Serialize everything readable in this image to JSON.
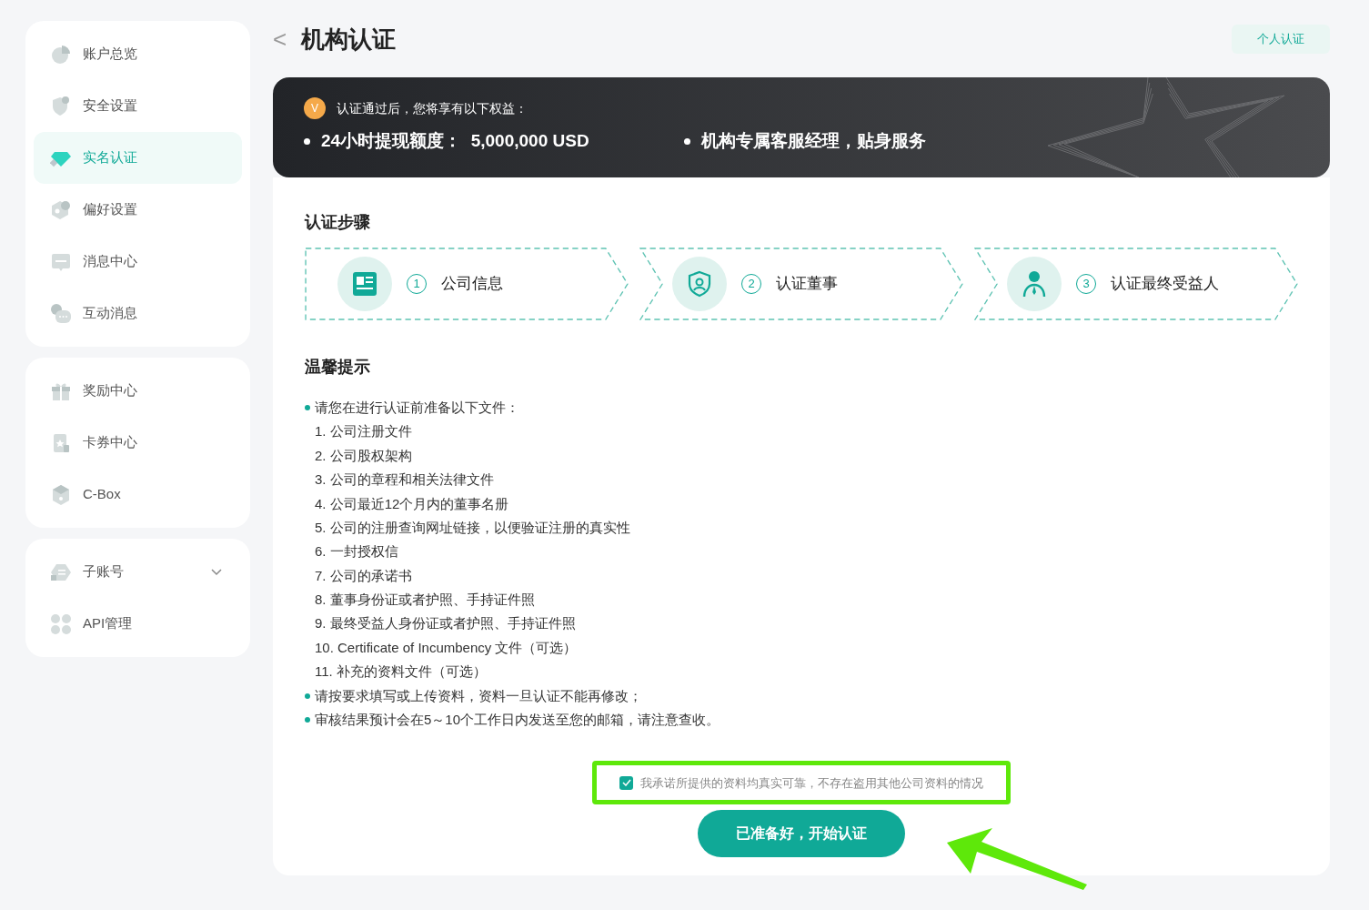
{
  "sidebar": {
    "groups": [
      {
        "items": [
          {
            "label": "账户总览",
            "selected": false
          },
          {
            "label": "安全设置",
            "selected": false
          },
          {
            "label": "实名认证",
            "selected": true
          },
          {
            "label": "偏好设置",
            "selected": false
          },
          {
            "label": "消息中心",
            "selected": false
          },
          {
            "label": "互动消息",
            "selected": false
          }
        ]
      },
      {
        "items": [
          {
            "label": "奖励中心",
            "selected": false
          },
          {
            "label": "卡券中心",
            "selected": false
          },
          {
            "label": "C-Box",
            "selected": false
          }
        ]
      },
      {
        "items": [
          {
            "label": "子账号",
            "selected": false,
            "expandable": true
          },
          {
            "label": "API管理",
            "selected": false
          }
        ]
      }
    ]
  },
  "header": {
    "back": "<",
    "title": "机构认证",
    "action": "个人认证"
  },
  "banner": {
    "badge": "V",
    "intro": "认证通过后，您将享有以下权益：",
    "benefits": [
      "24小时提现额度：  5,000,000 USD",
      "机构专属客服经理，贴身服务"
    ]
  },
  "steps": {
    "title": "认证步骤",
    "items": [
      {
        "number": "1",
        "label": "公司信息"
      },
      {
        "number": "2",
        "label": "认证董事"
      },
      {
        "number": "3",
        "label": "认证最终受益人"
      }
    ]
  },
  "tips": {
    "title": "温馨提示",
    "lines": [
      {
        "kind": "bullet",
        "text": "请您在进行认证前准备以下文件："
      },
      {
        "kind": "numbered",
        "text": "1. 公司注册文件"
      },
      {
        "kind": "numbered",
        "text": "2. 公司股权架构"
      },
      {
        "kind": "numbered",
        "text": "3. 公司的章程和相关法律文件"
      },
      {
        "kind": "numbered",
        "text": "4. 公司最近12个月内的董事名册"
      },
      {
        "kind": "numbered",
        "text": "5. 公司的注册查询网址链接，以便验证注册的真实性"
      },
      {
        "kind": "numbered",
        "text": "6. 一封授权信"
      },
      {
        "kind": "numbered",
        "text": "7. 公司的承诺书"
      },
      {
        "kind": "numbered",
        "text": "8. 董事身份证或者护照、手持证件照"
      },
      {
        "kind": "numbered",
        "text": "9. 最终受益人身份证或者护照、手持证件照"
      },
      {
        "kind": "numbered",
        "text": "10. Certificate of Incumbency 文件（可选）"
      },
      {
        "kind": "numbered",
        "text": "11. 补充的资料文件（可选）"
      },
      {
        "kind": "bullet",
        "text": "请按要求填写或上传资料，资料一旦认证不能再修改；"
      },
      {
        "kind": "bullet",
        "text": "审核结果预计会在5～10个工作日内发送至您的邮箱，请注意查收。"
      }
    ]
  },
  "agreement": {
    "checked": true,
    "label": "我承诺所提供的资料均真实可靠，不存在盗用其他公司资料的情况"
  },
  "start_button": "已准备好，开始认证"
}
